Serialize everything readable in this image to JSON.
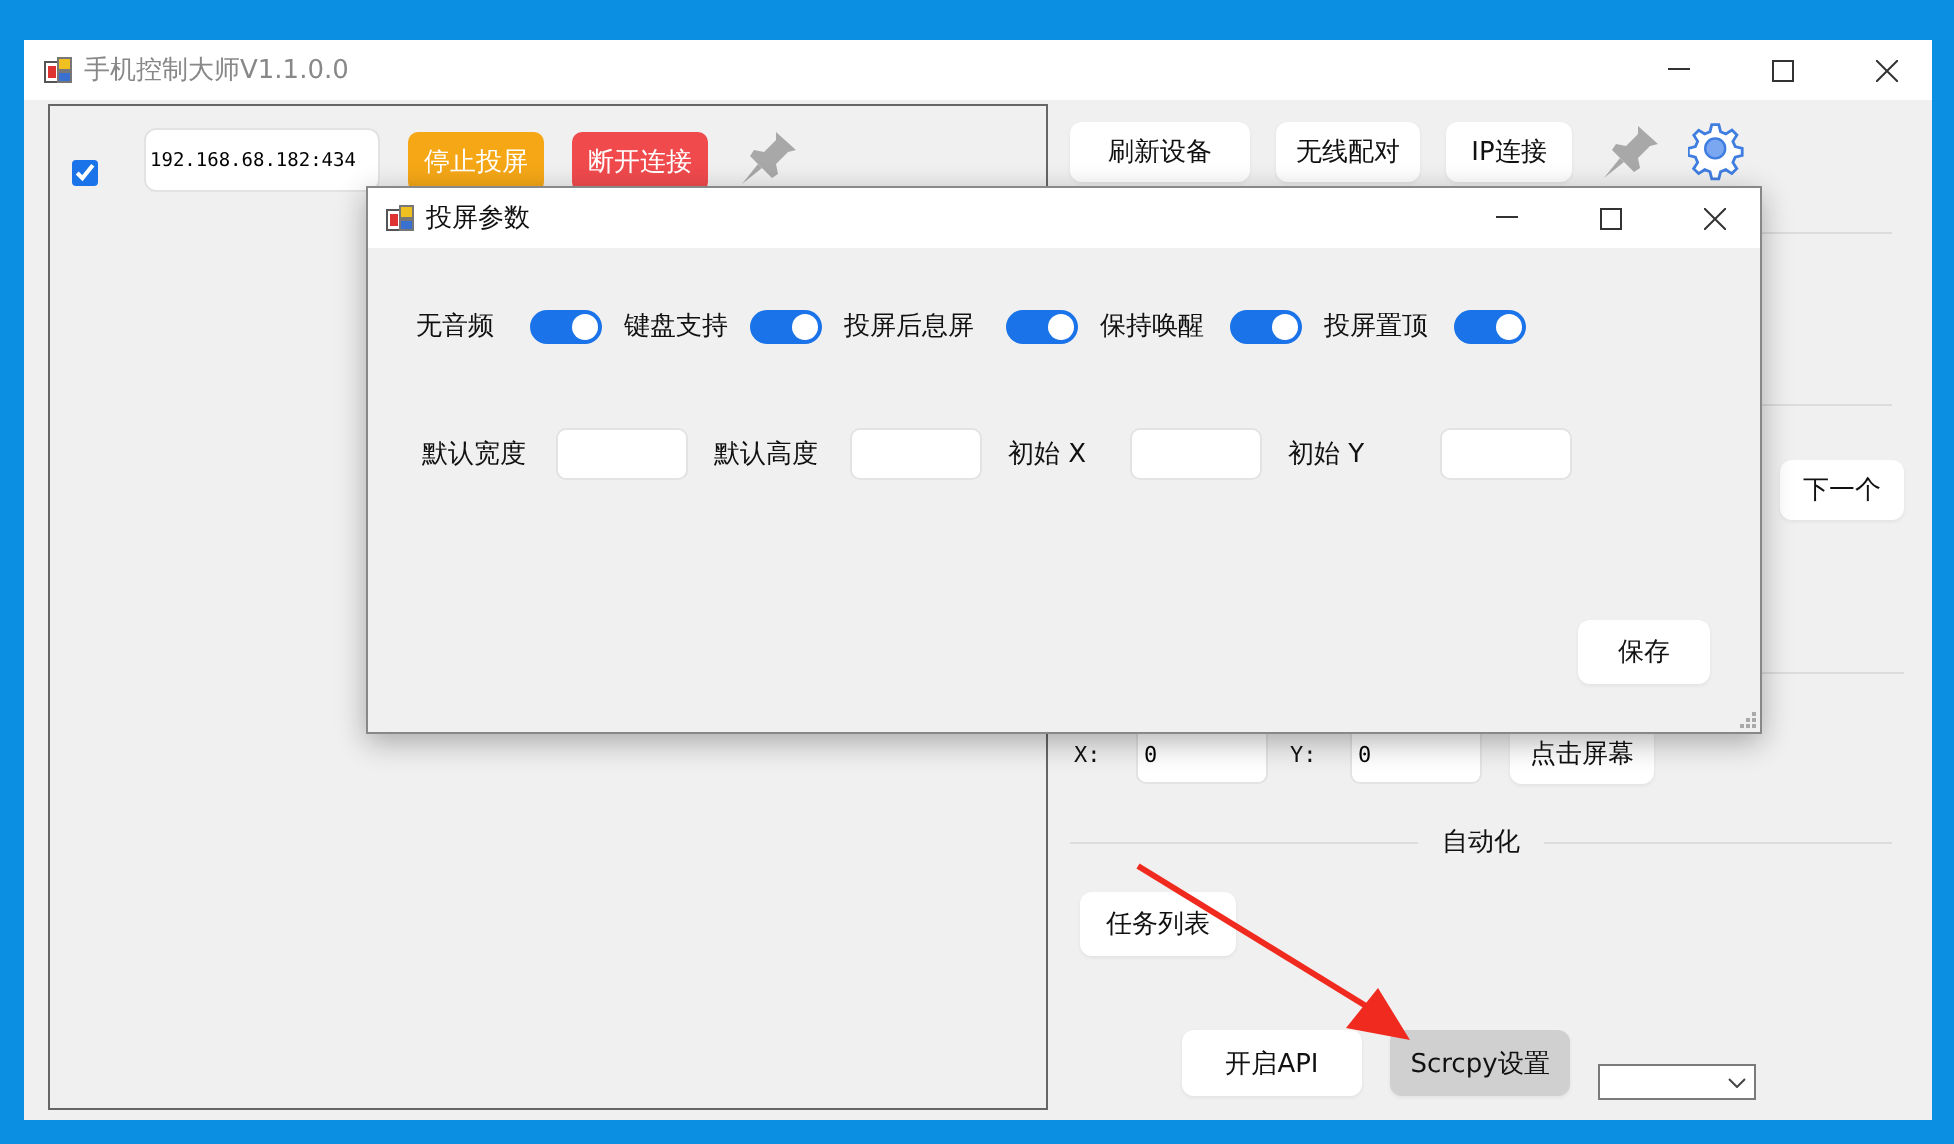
{
  "window": {
    "title": "手机控制大师V1.1.0.0"
  },
  "device": {
    "checked": true,
    "address": "192.168.68.182:434",
    "buttons": [
      {
        "label": "停止投屏",
        "kind": "warning"
      },
      {
        "label": "断开连接",
        "kind": "danger"
      }
    ]
  },
  "toolbar": {
    "buttons": [
      "刷新设备",
      "无线配对",
      "IP连接"
    ]
  },
  "next_button": "下一个",
  "tap": {
    "x_label": "X:",
    "x_value": "0",
    "y_label": "Y:",
    "y_value": "0",
    "button": "点击屏幕"
  },
  "automation": {
    "heading": "自动化",
    "task_button": "任务列表"
  },
  "bottom_buttons": [
    {
      "label": "开启API",
      "selected": false
    },
    {
      "label": "Scrcpy设置",
      "selected": true
    }
  ],
  "dialog": {
    "title": "投屏参数",
    "toggles": [
      {
        "label": "无音频",
        "on": true
      },
      {
        "label": "键盘支持",
        "on": true
      },
      {
        "label": "投屏后息屏",
        "on": true
      },
      {
        "label": "保持唤醒",
        "on": true
      },
      {
        "label": "投屏置顶",
        "on": true
      }
    ],
    "fields": [
      {
        "label": "默认宽度"
      },
      {
        "label": "默认高度"
      },
      {
        "label": "初始 X"
      },
      {
        "label": "初始 Y"
      }
    ],
    "save": "保存"
  }
}
